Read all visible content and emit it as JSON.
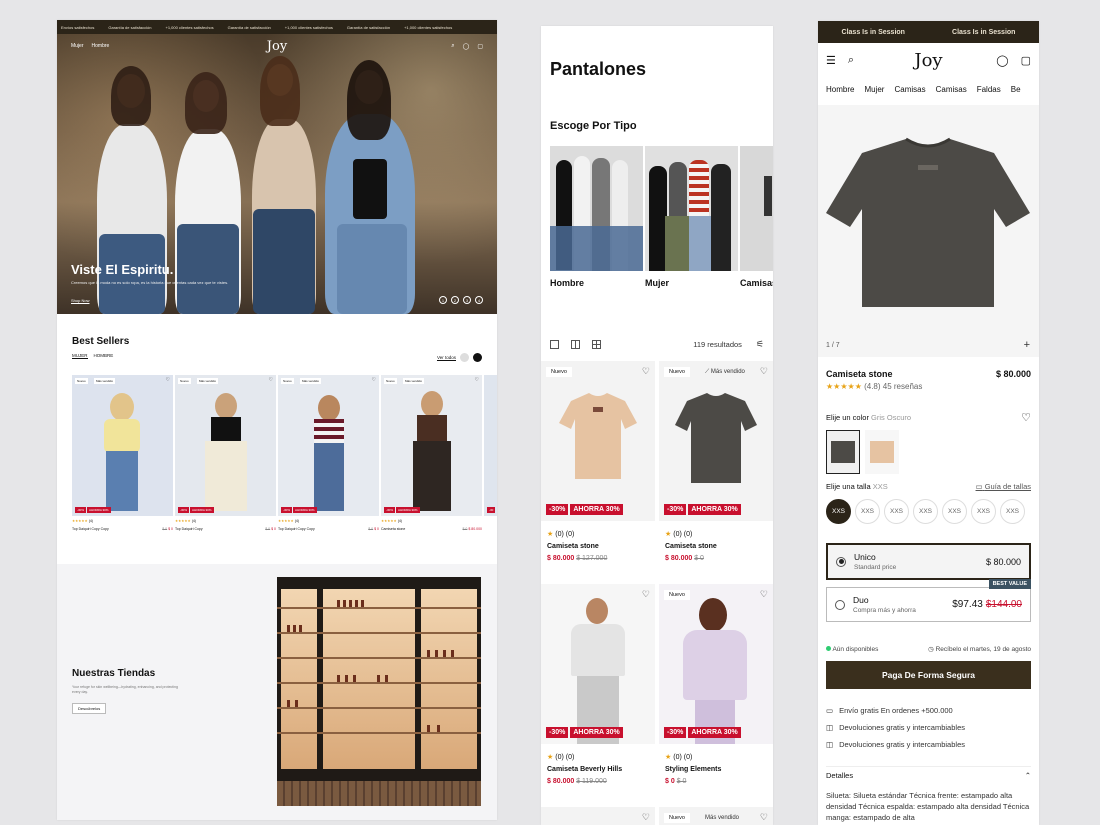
{
  "desktop": {
    "ticker": [
      "Envíos satisfechos",
      "Garantía de satisfacción",
      "+1,000 clientes satisfechos",
      "Garantía de satisfacción",
      "+1,000 clientes satisfechos",
      "Garantía de satisfacción",
      "+1,000 clientes satisfechos"
    ],
    "nav": {
      "links": [
        "Mujer",
        "Hombre"
      ],
      "logo": "Joy",
      "icons": [
        "search-icon",
        "user-icon",
        "bag-icon"
      ]
    },
    "hero": {
      "title": "Viste El Espiritu.",
      "subtitle": "Creemos que la moda no es solo ropa, es la historia que cuentas cada vez que te vistes.",
      "cta": "Shop Now",
      "dots": [
        "1",
        "2",
        "3",
        "4"
      ]
    },
    "best_sellers": {
      "title": "Best Sellers",
      "tabs": [
        "MUJER",
        "HOMBRE"
      ],
      "view_all": "Ver todos",
      "products": [
        {
          "tag": "Nuevo",
          "mas": "Más vendido",
          "rating": "(4)",
          "name": "Top Daiquiri Copy Copy",
          "price": "$ 0",
          "old": "$ 0"
        },
        {
          "tag": "Nuevo",
          "mas": "Más vendido",
          "rating": "(4)",
          "name": "Top Daiquiri Copy",
          "price": "$ 0",
          "old": "$ 0"
        },
        {
          "tag": "Nuevo",
          "mas": "Más vendido",
          "rating": "(4)",
          "name": "Top Daiquiri Copy Copy",
          "price": "$ 0",
          "old": "$ 0"
        },
        {
          "tag": "Nuevo",
          "mas": "Más vendido",
          "rating": "(4)",
          "name": "Camiseta stone",
          "price": "$ 80.000",
          "old": "$ 0"
        }
      ],
      "badge_off": "-30%",
      "badge_save": "AHORRA 30%"
    },
    "stores": {
      "title": "Nuestras Tiendas",
      "subtitle": "Your refuge for skin wellbeing—hydrating, enhancing, and protecting every day.",
      "button": "Descúbrelos"
    }
  },
  "mobile_list": {
    "title": "Pantalones",
    "subtitle": "Escoge Por Tipo",
    "types": [
      "Hombre",
      "Mujer",
      "Camisas"
    ],
    "results": "119 resultados",
    "products": [
      {
        "tag": "Nuevo",
        "mas": "",
        "rating": "(0)",
        "reviews": "(0)",
        "name": "Camiseta stone",
        "price": "$ 80.000",
        "old": "$ 127.000",
        "color": "#e6c3a2"
      },
      {
        "tag": "Nuevo",
        "mas": "Más vendido",
        "rating": "(0)",
        "reviews": "(0)",
        "name": "Camiseta stone",
        "price": "$ 80.000",
        "old": "$ 0",
        "color": "#4c4a46"
      },
      {
        "tag": "",
        "mas": "",
        "rating": "(0)",
        "reviews": "(0)",
        "name": "Camiseta Beverly Hills",
        "price": "$ 80.000",
        "old": "$ 119.000",
        "color": "#d7d7d7"
      },
      {
        "tag": "Nuevo",
        "mas": "",
        "rating": "(0)",
        "reviews": "(0)",
        "name": "Styling Elements",
        "price": "$ 0",
        "old": "$ 0",
        "color": "#ddd0e6"
      }
    ],
    "bottom": {
      "tag": "Nuevo",
      "mas": "Más vendido"
    },
    "badge_off": "-30%",
    "badge_save": "AHORRA 30%"
  },
  "pdp": {
    "ticker": [
      "Class Is in Session",
      "Class Is in Session"
    ],
    "logo": "Joy",
    "categories": [
      "Hombre",
      "Mujer",
      "Camisas",
      "Camisas",
      "Faldas",
      "Be"
    ],
    "image_count": "1 / 7",
    "name": "Camiseta stone",
    "price": "$ 80.000",
    "stars": "★★★★★",
    "rating": "(4.8) 45 reseñas",
    "color_label": "Elije un color",
    "color_value": "Gris Oscuro",
    "size_label": "Elije una talla",
    "size_value": "XXS",
    "size_guide": "Guía de tallas",
    "sizes": [
      "XXS",
      "XXS",
      "XXS",
      "XXS",
      "XXS",
      "XXS",
      "XXS"
    ],
    "option1": {
      "name": "Unico",
      "desc": "Standard price",
      "price": "$ 80.000"
    },
    "option2": {
      "name": "Duo",
      "desc": "Compra más y ahorra",
      "price": "$97.43",
      "old": "$144.00",
      "badge": "BEST VALUE"
    },
    "stock": "Aún disponibles",
    "delivery": "Recíbelo el martes, 19 de agosto",
    "pay": "Paga De Forma Segura",
    "perks": [
      "Envío gratis En ordenes +500.000",
      "Devoluciones gratis y intercambiables",
      "Devoluciones gratis y intercambiables"
    ],
    "details_title": "Detalles",
    "details_text": "Silueta: Silueta estándar  Técnica frente: estampado alta densidad  Técnica espalda: estampado alta densidad Técnica manga: estampado de alta"
  }
}
